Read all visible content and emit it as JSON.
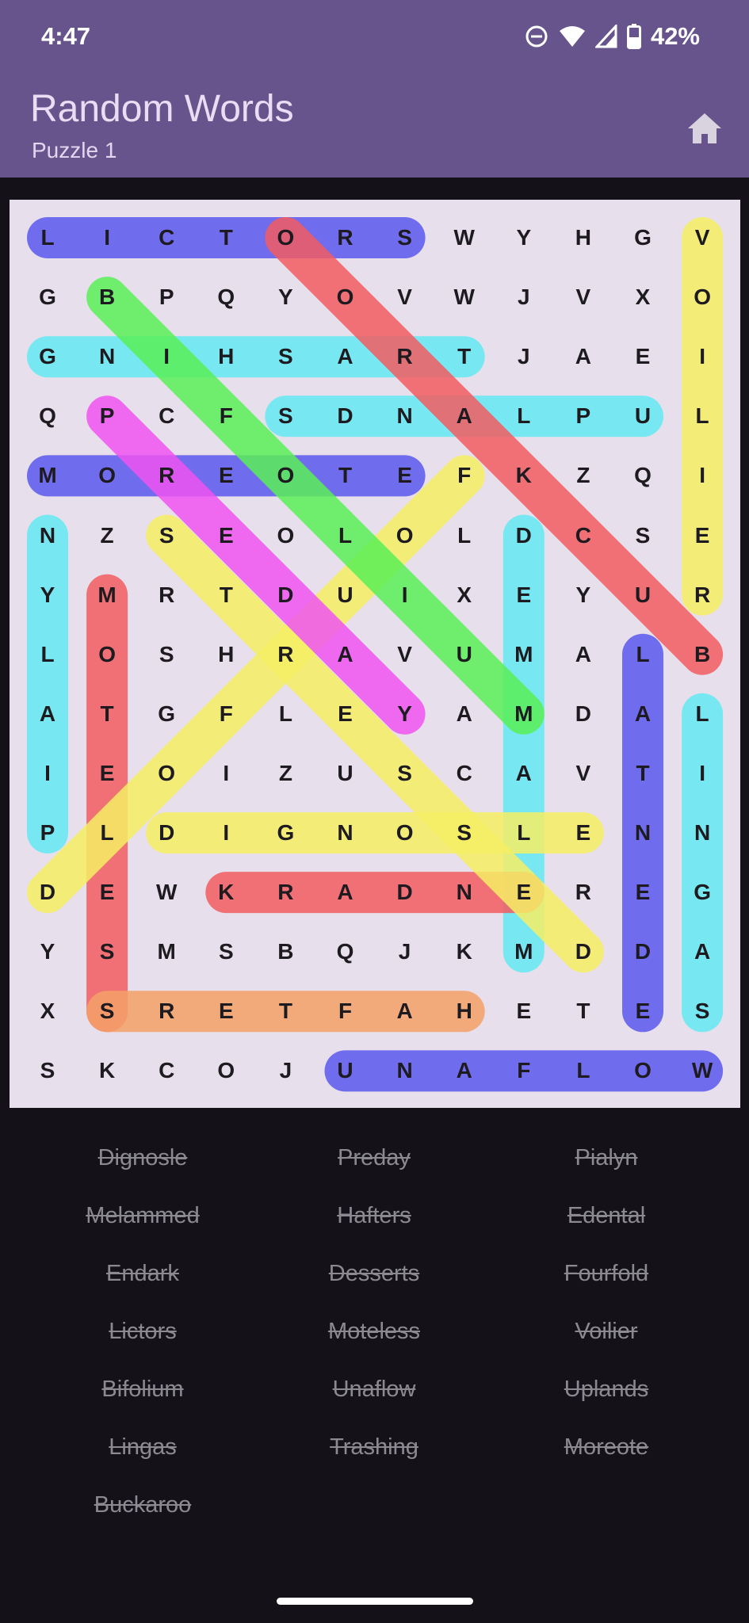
{
  "status_bar": {
    "time": "4:47",
    "battery": "42%",
    "icons": [
      "do-not-disturb-icon",
      "wifi-icon",
      "signal-icon",
      "battery-icon"
    ]
  },
  "app_bar": {
    "title": "Random Words",
    "subtitle": "Puzzle 1",
    "home_icon": "home-icon"
  },
  "grid": [
    [
      "L",
      "I",
      "C",
      "T",
      "O",
      "R",
      "S",
      "W",
      "Y",
      "H",
      "G",
      "V"
    ],
    [
      "G",
      "B",
      "P",
      "Q",
      "Y",
      "O",
      "V",
      "W",
      "J",
      "V",
      "X",
      "O"
    ],
    [
      "G",
      "N",
      "I",
      "H",
      "S",
      "A",
      "R",
      "T",
      "J",
      "A",
      "E",
      "I"
    ],
    [
      "Q",
      "P",
      "C",
      "F",
      "S",
      "D",
      "N",
      "A",
      "L",
      "P",
      "U",
      "L"
    ],
    [
      "M",
      "O",
      "R",
      "E",
      "O",
      "T",
      "E",
      "F",
      "K",
      "Z",
      "Q",
      "I"
    ],
    [
      "N",
      "Z",
      "S",
      "E",
      "O",
      "L",
      "O",
      "L",
      "D",
      "C",
      "S",
      "E"
    ],
    [
      "Y",
      "M",
      "R",
      "T",
      "D",
      "U",
      "I",
      "X",
      "E",
      "Y",
      "U",
      "R"
    ],
    [
      "L",
      "O",
      "S",
      "H",
      "R",
      "A",
      "V",
      "U",
      "M",
      "A",
      "L",
      "B"
    ],
    [
      "A",
      "T",
      "G",
      "F",
      "L",
      "E",
      "Y",
      "A",
      "M",
      "D",
      "A",
      "L"
    ],
    [
      "I",
      "E",
      "O",
      "I",
      "Z",
      "U",
      "S",
      "C",
      "A",
      "V",
      "T",
      "I"
    ],
    [
      "P",
      "L",
      "D",
      "I",
      "G",
      "N",
      "O",
      "S",
      "L",
      "E",
      "N",
      "N"
    ],
    [
      "D",
      "E",
      "W",
      "K",
      "R",
      "A",
      "D",
      "N",
      "E",
      "R",
      "E",
      "G"
    ],
    [
      "Y",
      "S",
      "M",
      "S",
      "B",
      "Q",
      "J",
      "K",
      "M",
      "D",
      "D",
      "A"
    ],
    [
      "X",
      "S",
      "R",
      "E",
      "T",
      "F",
      "A",
      "H",
      "E",
      "T",
      "E",
      "S"
    ],
    [
      "S",
      "K",
      "C",
      "O",
      "J",
      "U",
      "N",
      "A",
      "F",
      "L",
      "O",
      "W"
    ]
  ],
  "found_words": [
    {
      "word": "Lictors",
      "from": [
        0,
        0
      ],
      "to": [
        0,
        6
      ],
      "color": "#5b57ee"
    },
    {
      "word": "Moreote",
      "from": [
        4,
        0
      ],
      "to": [
        4,
        6
      ],
      "color": "#5b57ee"
    },
    {
      "word": "Edental",
      "from": [
        13,
        10
      ],
      "to": [
        7,
        10
      ],
      "color": "#5b57ee"
    },
    {
      "word": "Unaflow",
      "from": [
        14,
        5
      ],
      "to": [
        14,
        11
      ],
      "color": "#5b57ee"
    },
    {
      "word": "Trashing",
      "from": [
        2,
        7
      ],
      "to": [
        2,
        0
      ],
      "color": "#63e9f2"
    },
    {
      "word": "Uplands",
      "from": [
        3,
        10
      ],
      "to": [
        3,
        4
      ],
      "color": "#63e9f2"
    },
    {
      "word": "Pialyn",
      "from": [
        10,
        0
      ],
      "to": [
        5,
        0
      ],
      "color": "#63e9f2"
    },
    {
      "word": "Melammed",
      "from": [
        12,
        8
      ],
      "to": [
        5,
        8
      ],
      "color": "#63e9f2"
    },
    {
      "word": "Lingas",
      "from": [
        8,
        11
      ],
      "to": [
        13,
        11
      ],
      "color": "#63e9f2"
    },
    {
      "word": "Buckaroo",
      "from": [
        7,
        11
      ],
      "to": [
        0,
        4
      ],
      "color": "#f25c62"
    },
    {
      "word": "Moteless",
      "from": [
        6,
        1
      ],
      "to": [
        13,
        1
      ],
      "color": "#f25c62"
    },
    {
      "word": "Endark",
      "from": [
        11,
        8
      ],
      "to": [
        11,
        3
      ],
      "color": "#f25c62"
    },
    {
      "word": "Voilier",
      "from": [
        0,
        11
      ],
      "to": [
        6,
        11
      ],
      "color": "#f4ef64"
    },
    {
      "word": "Fourfold",
      "from": [
        4,
        7
      ],
      "to": [
        11,
        0
      ],
      "color": "#f4ef64"
    },
    {
      "word": "Desserts",
      "from": [
        12,
        9
      ],
      "to": [
        5,
        2
      ],
      "color": "#f4ef64"
    },
    {
      "word": "Dignosle",
      "from": [
        10,
        2
      ],
      "to": [
        10,
        9
      ],
      "color": "#f4ef64"
    },
    {
      "word": "Bifolium",
      "from": [
        1,
        1
      ],
      "to": [
        8,
        8
      ],
      "color": "#59ee56"
    },
    {
      "word": "Preday",
      "from": [
        3,
        1
      ],
      "to": [
        8,
        6
      ],
      "color": "#ee53f0"
    },
    {
      "word": "Hafters",
      "from": [
        13,
        7
      ],
      "to": [
        13,
        1
      ],
      "color": "#f4a067"
    }
  ],
  "word_list": [
    [
      "Dignosle",
      "Preday",
      "Pialyn"
    ],
    [
      "Melammed",
      "Hafters",
      "Edental"
    ],
    [
      "Endark",
      "Desserts",
      "Fourfold"
    ],
    [
      "Lictors",
      "Moteless",
      "Voilier"
    ],
    [
      "Bifolium",
      "Unaflow",
      "Uplands"
    ],
    [
      "Lingas",
      "Trashing",
      "Moreote"
    ],
    [
      "Buckaroo"
    ]
  ]
}
